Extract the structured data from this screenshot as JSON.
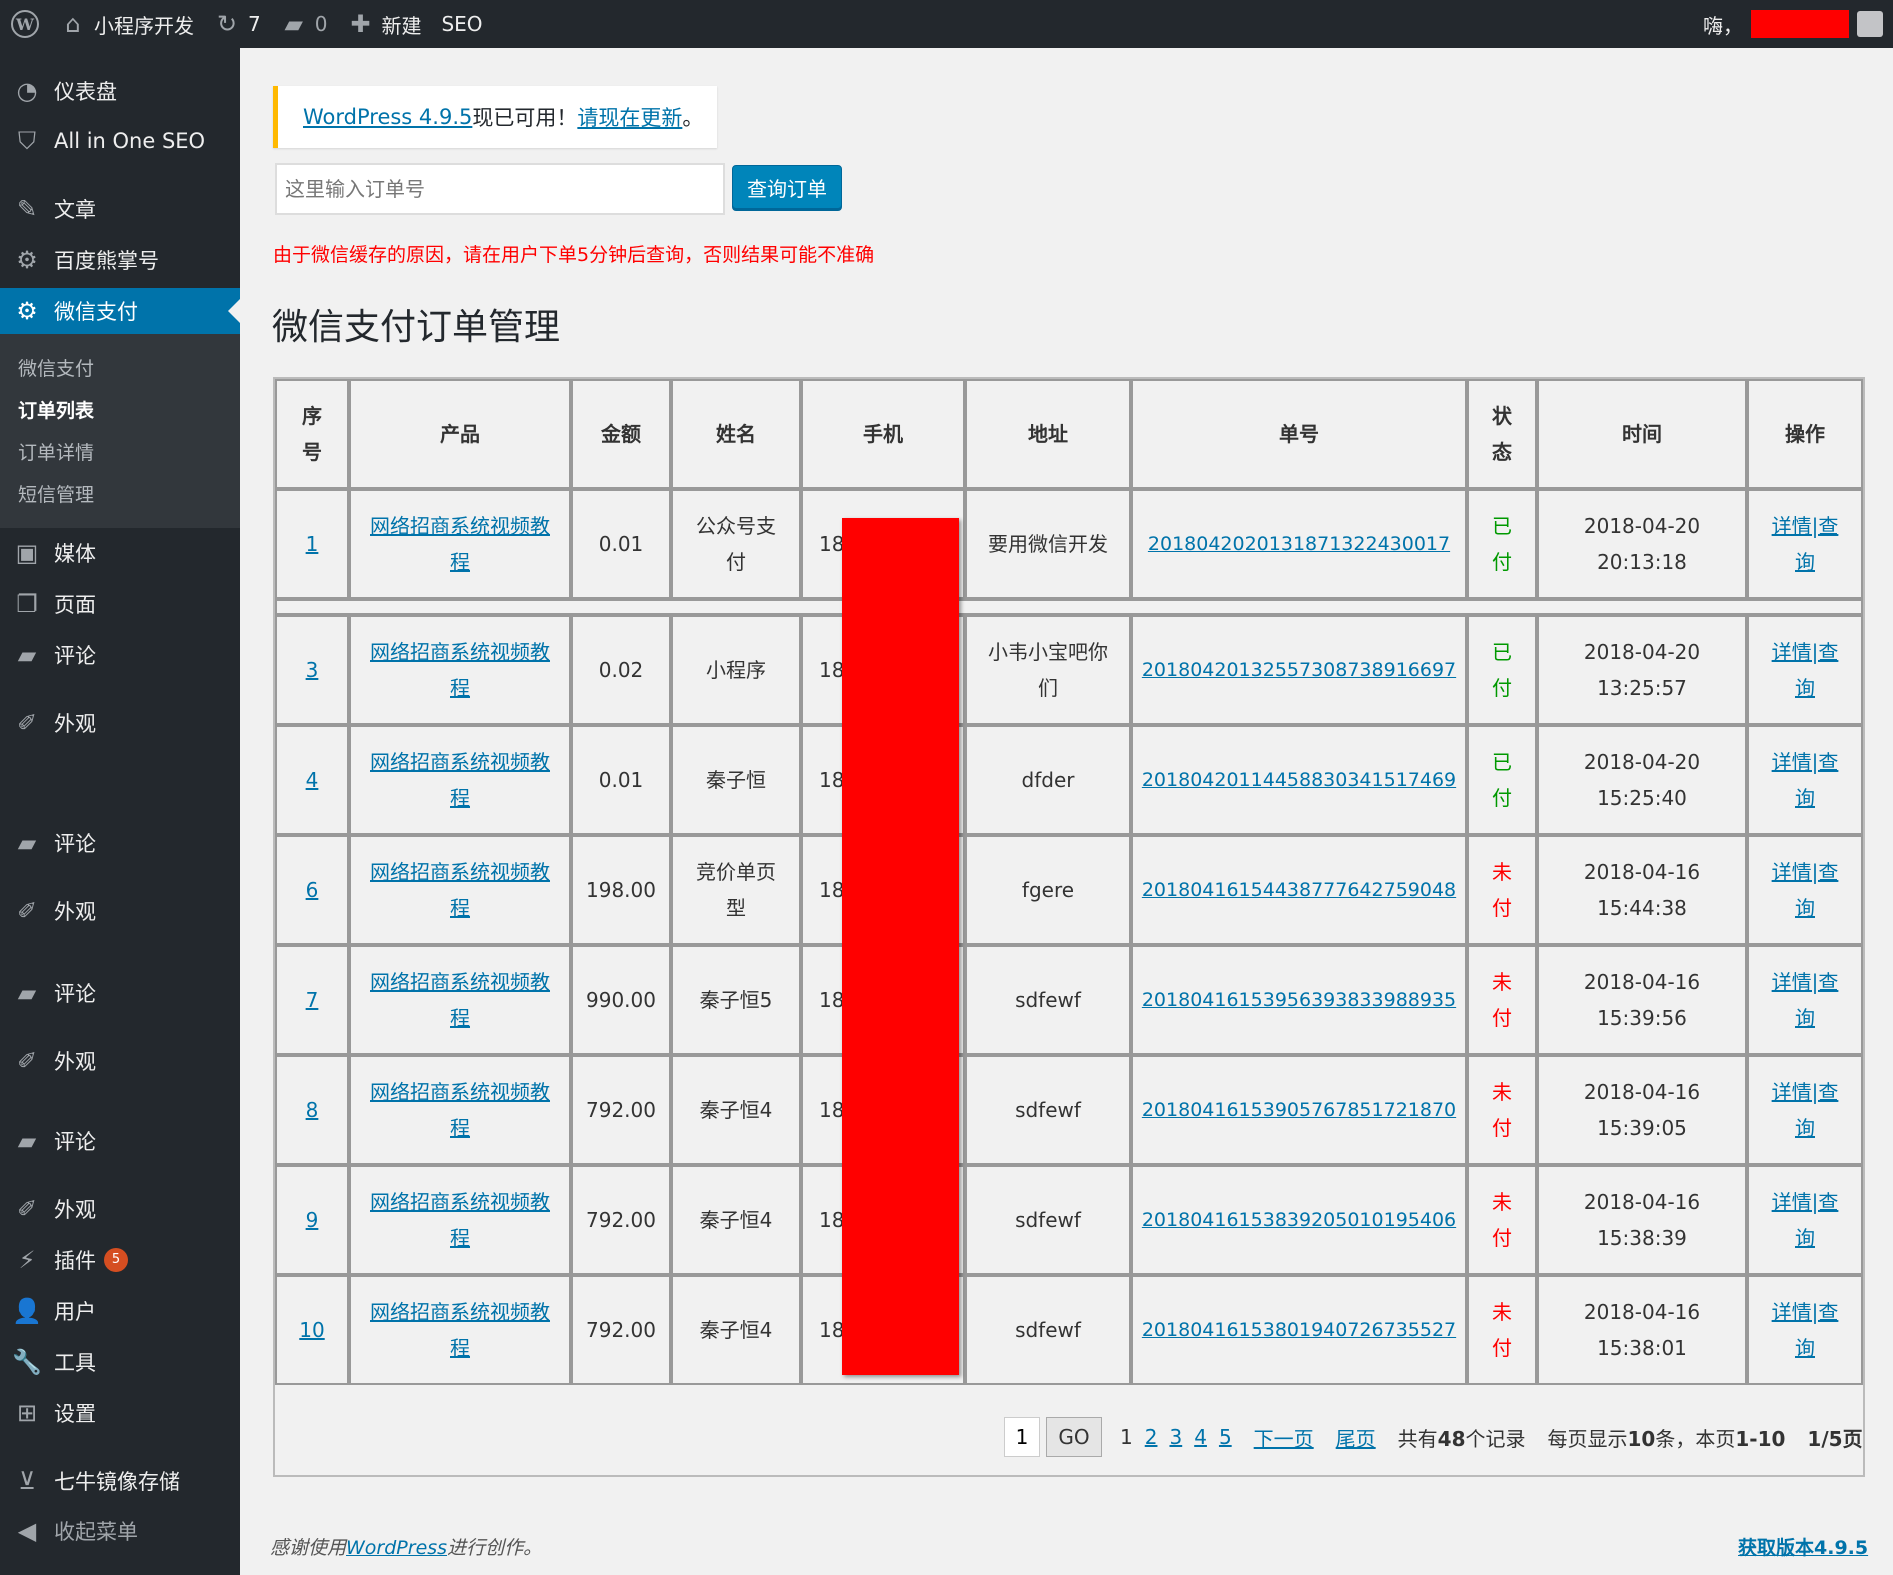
{
  "adminbar": {
    "site_name": "小程序开发",
    "updates_count": "7",
    "comments_count": "0",
    "new_label": "新建",
    "seo_label": "SEO",
    "greeting": "嗨，"
  },
  "sidebar": {
    "items_top": [
      {
        "label": "仪表盘",
        "icon": "dashboard-icon"
      },
      {
        "label": "All in One SEO",
        "icon": "shield-icon"
      },
      {
        "label": "文章",
        "icon": "pin-icon"
      },
      {
        "label": "百度熊掌号",
        "icon": "gear-icon"
      },
      {
        "label": "微信支付",
        "icon": "gear-icon"
      }
    ],
    "submenu": [
      {
        "label": "微信支付"
      },
      {
        "label": "订单列表"
      },
      {
        "label": "订单详情"
      },
      {
        "label": "短信管理"
      }
    ],
    "items_bottom": [
      {
        "label": "媒体"
      },
      {
        "label": "页面"
      },
      {
        "label": "评论"
      },
      {
        "label": "外观"
      },
      {
        "label": "评论"
      },
      {
        "label": "外观"
      },
      {
        "label": "评论"
      },
      {
        "label": "外观"
      },
      {
        "label": "评论"
      },
      {
        "label": "外观"
      },
      {
        "label": "插件",
        "badge": "5"
      },
      {
        "label": "用户"
      },
      {
        "label": "工具"
      },
      {
        "label": "设置"
      },
      {
        "label": "七牛镜像存储"
      },
      {
        "label": "收起菜单"
      }
    ]
  },
  "notice": {
    "link_text": "WordPress 4.9.5",
    "middle_text": "现已可用！",
    "update_link": "请现在更新",
    "end_text": "。"
  },
  "search": {
    "placeholder": "这里输入订单号",
    "button_label": "查询订单"
  },
  "warning_text": "由于微信缓存的原因，请在用户下单5分钟后查询，否则结果可能不准确",
  "page_title": "微信支付订单管理",
  "table": {
    "headers": [
      "序号",
      "产品",
      "金额",
      "姓名",
      "手机",
      "地址",
      "单号",
      "状态",
      "时间",
      "操作"
    ],
    "rows": [
      {
        "id": "1",
        "product": "网络招商系统视频教程",
        "amount": "0.01",
        "name": "公众号支付",
        "phone": "18",
        "address": "要用微信开发",
        "order_no": "2018042020131871322430017",
        "status": "已付",
        "time": "2018-04-20 20:13:18",
        "action": "详情|查询"
      },
      {
        "id": "3",
        "product": "网络招商系统视频教程",
        "amount": "0.02",
        "name": "小程序",
        "phone": "18",
        "address": "小韦小宝吧你们",
        "order_no": "2018042013255730873891669​7",
        "status": "已付",
        "time": "2018-04-20 13:25:57",
        "action": "详情|查询"
      },
      {
        "id": "4",
        "product": "网络招商系统视频教程",
        "amount": "0.01",
        "name": "秦子恒",
        "phone": "18",
        "address": "dfder",
        "order_no": "2018042011445883034151746​9",
        "status": "已付",
        "time": "2018-04-20 15:25:40",
        "action": "详情|查询"
      },
      {
        "id": "6",
        "product": "网络招商系统视频教程",
        "amount": "198.00",
        "name": "竞价单页型",
        "phone": "18",
        "address": "fgere",
        "order_no": "2018041615443877764275904​8",
        "status": "未付",
        "time": "2018-04-16 15:44:38",
        "action": "详情|查询"
      },
      {
        "id": "7",
        "product": "网络招商系统视频教程",
        "amount": "990.00",
        "name": "秦子恒5",
        "phone": "18",
        "address": "sdfewf",
        "order_no": "2018041615395639383398893​5",
        "status": "未付",
        "time": "2018-04-16 15:39:56",
        "action": "详情|查询"
      },
      {
        "id": "8",
        "product": "网络招商系统视频教程",
        "amount": "792.00",
        "name": "秦子恒4",
        "phone": "18",
        "address": "sdfewf",
        "order_no": "2018041615390576785172187​0",
        "status": "未付",
        "time": "2018-04-16 15:39:05",
        "action": "详情|查询"
      },
      {
        "id": "9",
        "product": "网络招商系统视频教程",
        "amount": "792.00",
        "name": "秦子恒4",
        "phone": "18",
        "address": "sdfewf",
        "order_no": "2018041615383920501019540​6",
        "status": "未付",
        "time": "2018-04-16 15:38:39",
        "action": "详情|查询"
      },
      {
        "id": "10",
        "product": "网络招商系统视频教程",
        "amount": "792.00",
        "name": "秦子恒4",
        "phone": "18",
        "address": "sdfewf",
        "order_no": "2018041615380194072673552​7",
        "status": "未付",
        "time": "2018-04-16 15:38:01",
        "action": "详情|查询"
      }
    ]
  },
  "pagination": {
    "page_input": "1",
    "go_label": "GO",
    "current": "1",
    "pages": [
      "2",
      "3",
      "4",
      "5"
    ],
    "next_label": "下一页",
    "last_label": "尾页",
    "total_prefix": "共有",
    "total": "48",
    "total_suffix": "个记录",
    "per_page_prefix": "每页显示",
    "per_page": "10",
    "per_page_mid": "条，本页",
    "range": "1-10",
    "page_of": "1/5",
    "page_suffix": "页"
  },
  "footer": {
    "thanks_prefix": "感谢使用",
    "wp_link": "WordPress",
    "thanks_suffix": "进行创作。",
    "version_link": "获取版本4.9.5"
  },
  "colors": {
    "adminbar_bg": "#23282d",
    "accent": "#0073aa",
    "paid": "#009900",
    "unpaid": "#ff0000",
    "notice_border": "#ffb900"
  }
}
